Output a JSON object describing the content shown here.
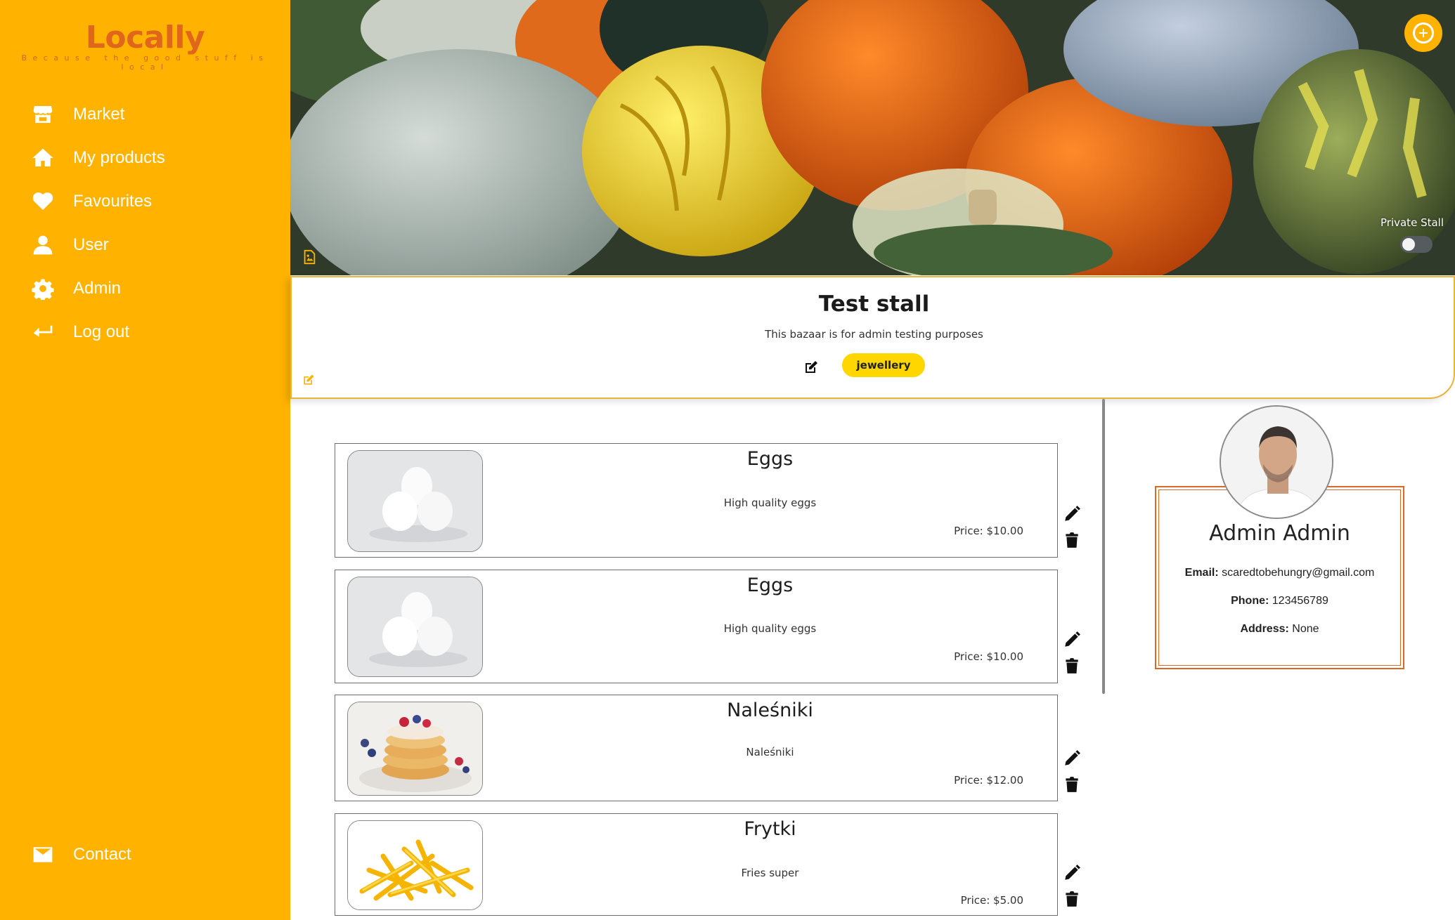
{
  "app": {
    "logo": "Locally",
    "tagline": "Because the good stuff is local"
  },
  "nav": {
    "items": [
      {
        "label": "Market",
        "icon": "store-icon"
      },
      {
        "label": "My products",
        "icon": "home-icon"
      },
      {
        "label": "Favourites",
        "icon": "heart-icon"
      },
      {
        "label": "User",
        "icon": "user-icon"
      },
      {
        "label": "Admin",
        "icon": "gear-icon"
      },
      {
        "label": "Log out",
        "icon": "logout-arrow-icon"
      }
    ],
    "contact": {
      "label": "Contact",
      "icon": "mail-icon"
    }
  },
  "banner": {
    "private_label": "Private Stall",
    "private_enabled": false
  },
  "stall": {
    "title": "Test stall",
    "description": "This bazaar is for admin testing purposes",
    "tag": "jewellery"
  },
  "products": [
    {
      "name": "Eggs",
      "description": "High quality eggs",
      "price": "Price: $10.00",
      "image": "eggs"
    },
    {
      "name": "Eggs",
      "description": "High quality eggs",
      "price": "Price: $10.00",
      "image": "eggs"
    },
    {
      "name": "Naleśniki",
      "description": "Naleśniki",
      "price": "Price: $12.00",
      "image": "pancakes"
    },
    {
      "name": "Frytki",
      "description": "Fries super",
      "price": "Price: $5.00",
      "image": "fries"
    }
  ],
  "owner": {
    "name": "Admin Admin",
    "email_label": "Email:",
    "email": "scaredtobehungry@gmail.com",
    "phone_label": "Phone:",
    "phone": "123456789",
    "address_label": "Address:",
    "address": "None"
  },
  "colors": {
    "sidebar": "#ffb300",
    "logo": "#e0661b",
    "tag": "#ffd600",
    "card_border": "#d86a28"
  }
}
